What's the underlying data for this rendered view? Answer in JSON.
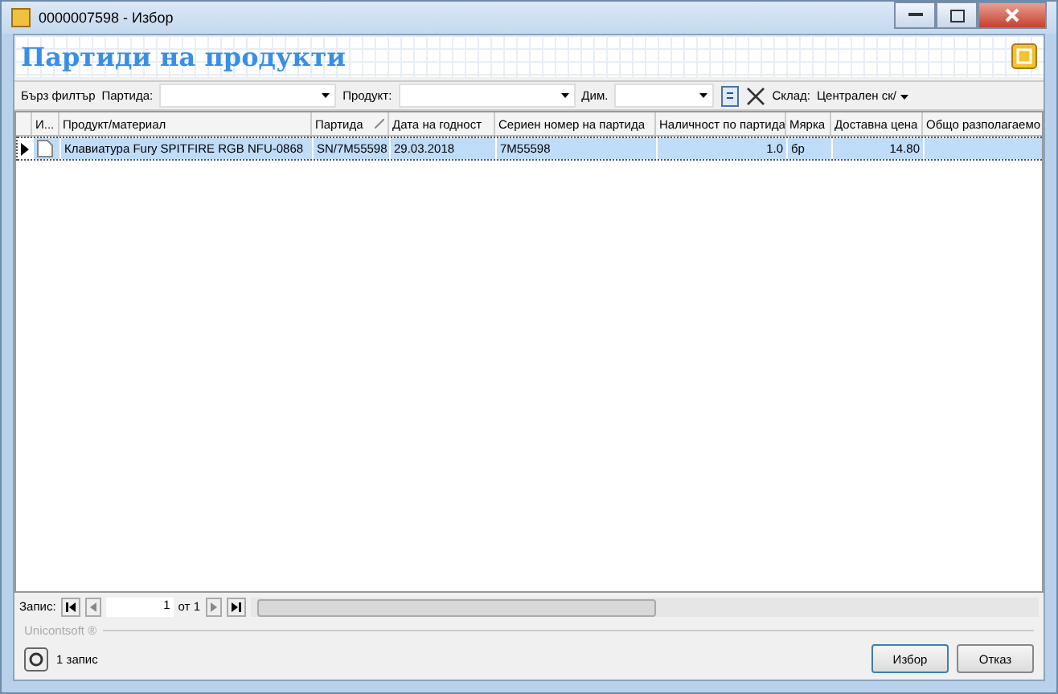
{
  "window": {
    "title": "0000007598 - Избор"
  },
  "header": {
    "title": "Партиди на продукти"
  },
  "toolbar": {
    "quick_filter": "Бърз филтър",
    "filters": [
      {
        "label": "Партида:",
        "kind": "combo"
      },
      {
        "label": "Продукт:",
        "kind": "combo"
      },
      {
        "label": "Дим.",
        "kind": "combo"
      }
    ],
    "warehouse_label": "Склад:",
    "warehouse_value": "Централен ск/"
  },
  "table": {
    "columns": [
      {
        "label": "И...",
        "kind": "icon",
        "sorted": false
      },
      {
        "label": "Продукт/материал",
        "kind": "text",
        "sorted": false
      },
      {
        "label": "Партида",
        "kind": "text",
        "sorted": true
      },
      {
        "label": "Дата на годност",
        "kind": "text",
        "sorted": false
      },
      {
        "label": "Сериен номер на партида",
        "kind": "text",
        "sorted": false
      },
      {
        "label": "Наличност по партида",
        "kind": "number",
        "sorted": false
      },
      {
        "label": "Мярка",
        "kind": "text",
        "sorted": false
      },
      {
        "label": "Доставна цена",
        "kind": "number",
        "sorted": false
      },
      {
        "label": "Общо разполагаемо",
        "kind": "text",
        "sorted": false
      }
    ],
    "rows": [
      {
        "selected": true,
        "cells": [
          "",
          "Клавиатура Fury SPITFIRE RGB NFU-0868",
          "SN/7M55598",
          "29.03.2018",
          "7M55598",
          "1.0",
          "бр",
          "14.80",
          ""
        ]
      }
    ]
  },
  "navigator": {
    "label": "Запис:",
    "current": "1",
    "total": "от 1"
  },
  "group_label": "Unicontsoft ®",
  "status": "1 запис",
  "buttons": [
    "Избор",
    "Отказ"
  ]
}
